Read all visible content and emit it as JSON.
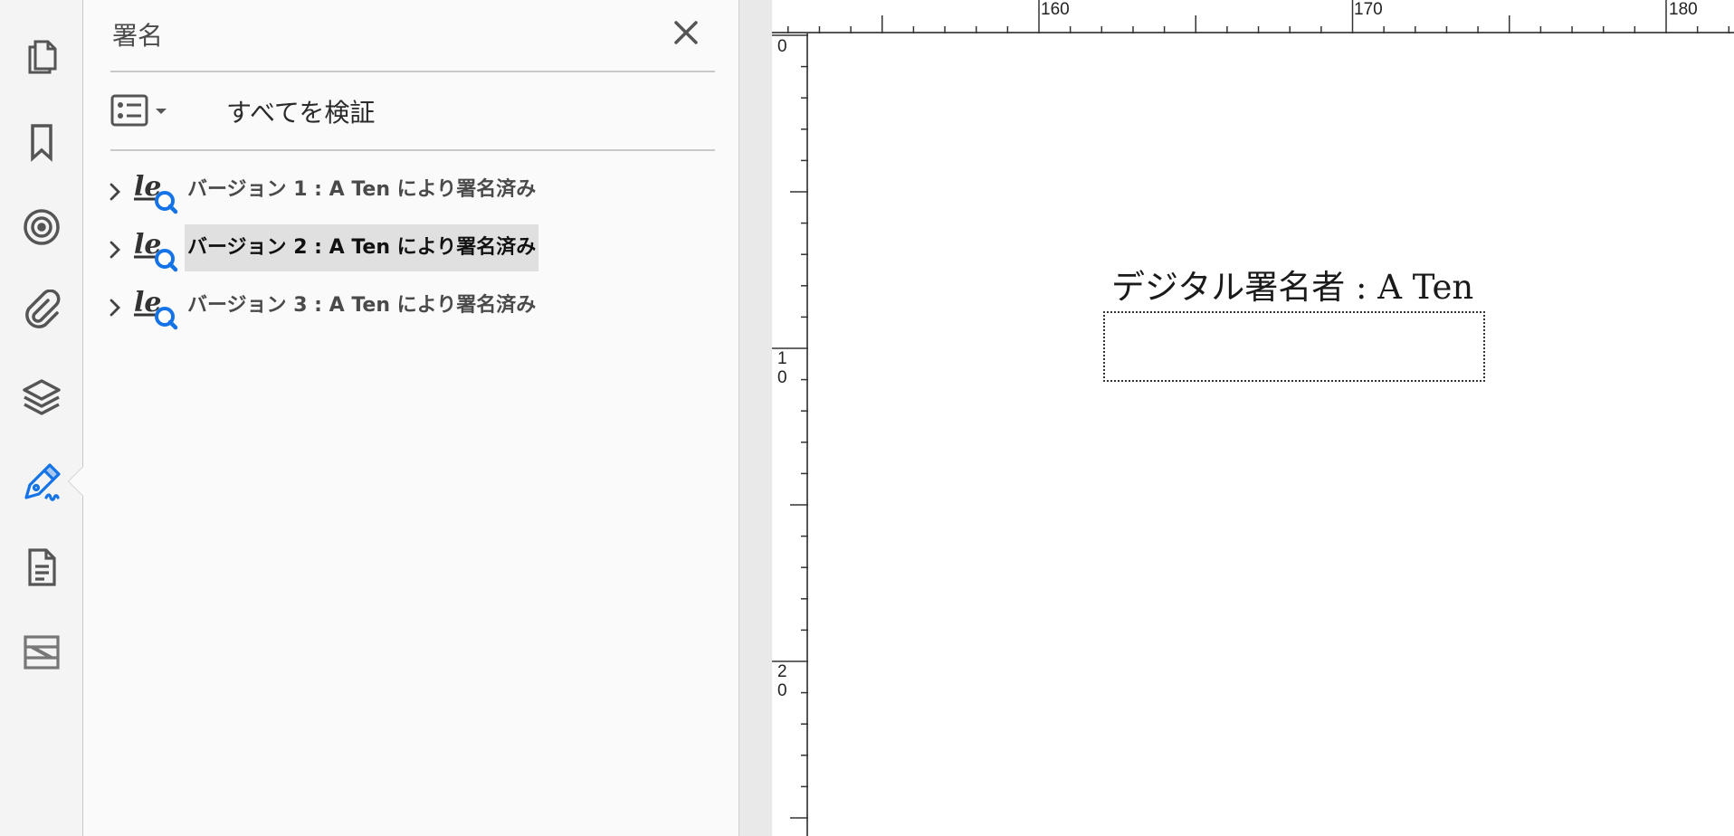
{
  "panel": {
    "title": "署名",
    "verify_all_label": "すべてを検証",
    "signatures": [
      {
        "label": "バージョン 1 : A Ten により署名済み",
        "selected": false
      },
      {
        "label": "バージョン 2 : A Ten により署名済み",
        "selected": true
      },
      {
        "label": "バージョン 3 : A Ten により署名済み",
        "selected": false
      }
    ]
  },
  "rail": {
    "items": [
      "pages-icon",
      "bookmark-icon",
      "target-icon",
      "attachment-icon",
      "layers-icon",
      "signature-pen-icon",
      "document-icon",
      "compare-icon"
    ],
    "active": "signature-pen-icon"
  },
  "ruler": {
    "top_labels": [
      "160",
      "170",
      "180"
    ],
    "left_labels": [
      {
        "line1": "0",
        "line2": ""
      },
      {
        "line1": "1",
        "line2": "0"
      },
      {
        "line1": "2",
        "line2": "0"
      }
    ]
  },
  "document": {
    "signature_caption": "デジタル署名者 : A Ten"
  },
  "colors": {
    "accent_blue": "#1473e6",
    "panel_bg": "#fafafa",
    "selected_bg": "#e0e0e0"
  }
}
